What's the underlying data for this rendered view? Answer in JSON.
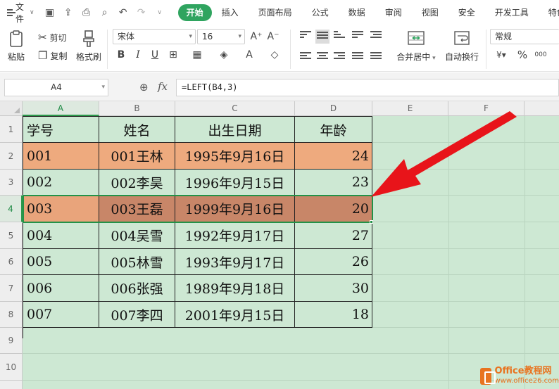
{
  "menu": {
    "file_label": "文件",
    "tabs": [
      "开始",
      "插入",
      "页面布局",
      "公式",
      "数据",
      "审阅",
      "视图",
      "安全",
      "开发工具",
      "特色"
    ],
    "active_tab": "开始",
    "active_color": "#2fa45f"
  },
  "ribbon": {
    "paste_label": "粘贴",
    "cut_label": "剪切",
    "copy_label": "复制",
    "format_painter_label": "格式刷",
    "font_name": "宋体",
    "font_size": "16",
    "merge_center_label": "合并居中",
    "wrap_text_label": "自动换行",
    "number_format": "常规",
    "percent_label": "%",
    "thousands_label": "000"
  },
  "formula_bar": {
    "cell_ref": "A4",
    "fx_label": "fx",
    "formula": "=LEFT(B4,3)"
  },
  "sheet": {
    "columns": [
      "A",
      "B",
      "C",
      "D",
      "E",
      "F"
    ],
    "rows": [
      "1",
      "2",
      "3",
      "4",
      "5",
      "6",
      "7",
      "8",
      "9",
      "10"
    ],
    "selected_column": "A",
    "selected_row": "4",
    "header": [
      "学号",
      "姓名",
      "出生日期",
      "年龄"
    ],
    "data": [
      [
        "001",
        "001王林",
        "1995年9月16日",
        "24"
      ],
      [
        "002",
        "002李昊",
        "1996年9月15日",
        "23"
      ],
      [
        "003",
        "003王磊",
        "1999年9月16日",
        "20"
      ],
      [
        "004",
        "004吴雪",
        "1992年9月17日",
        "27"
      ],
      [
        "005",
        "005林雪",
        "1993年9月17日",
        "26"
      ],
      [
        "006",
        "006张强",
        "1989年9月18日",
        "30"
      ],
      [
        "007",
        "007李四",
        "2001年9月15日",
        "18"
      ]
    ],
    "sheet_bg": "#cde8d3",
    "highlight_color": "#eeaa7e",
    "annotation_color": "#e8141a"
  },
  "watermark": {
    "name": "Office教程网",
    "url": "www.office26.com"
  }
}
